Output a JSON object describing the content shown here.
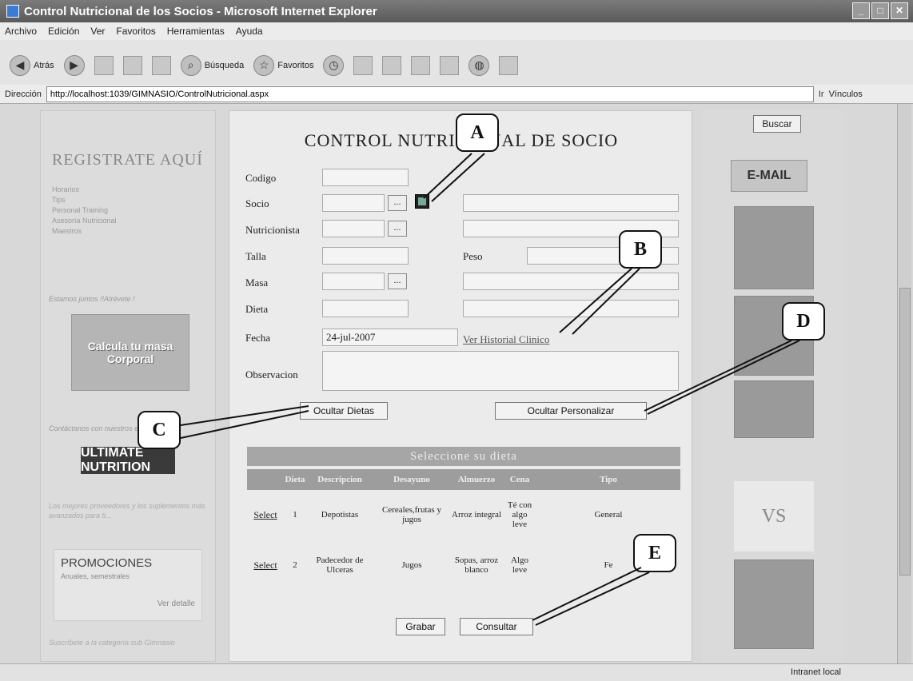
{
  "window": {
    "title": "Control Nutricional de los Socios - Microsoft Internet Explorer"
  },
  "menu": [
    "Archivo",
    "Edición",
    "Ver",
    "Favoritos",
    "Herramientas",
    "Ayuda"
  ],
  "toolbar": {
    "back": "Atrás",
    "search": "Búsqueda",
    "favorites": "Favoritos"
  },
  "address": {
    "label": "Dirección",
    "url": "http://localhost:1039/GIMNASIO/ControlNutricional.aspx",
    "go": "Ir",
    "links": "Vínculos"
  },
  "left": {
    "register": "REGISTRATE AQUÍ",
    "links": [
      "Horarios",
      "Tips",
      "Personal Training",
      "Asesoría Nutricional",
      "Maestros"
    ],
    "note1": "Estamos juntos !!Atrévete !",
    "imc": "Calcula tu masa Corporal",
    "note2": "Contáctanos con nuestros expertos",
    "brand": "ULTIMATE NUTRITION",
    "note3": "Los mejores proveedores y los suplementos más avanzados para ti...",
    "promo_title": "PROMOCIONES",
    "promo_sub": "Anuales, semestrales",
    "promo_link": "Ver detalle",
    "note4": "Suscríbete a la categoría sub Gimnasio"
  },
  "form": {
    "title": "CONTROL NUTRICIONAL DE SOCIO",
    "labels": {
      "codigo": "Codigo",
      "socio": "Socio",
      "nutricionista": "Nutricionista",
      "talla": "Talla",
      "peso": "Peso",
      "masa": "Masa",
      "dieta": "Dieta",
      "fecha": "Fecha",
      "observacion": "Observacion"
    },
    "fecha_value": "24-jul-2007",
    "dots": "...",
    "history_link": "Ver Historial Clinico",
    "btn_hide_diets": "Ocultar Dietas",
    "btn_hide_custom": "Ocultar Personalizar",
    "diet_header": "Seleccione su dieta",
    "columns": [
      "",
      "Dieta",
      "Descripcion",
      "Desayuno",
      "Almuerzo",
      "Cena",
      "Tipo"
    ],
    "rows": [
      {
        "select": "Select",
        "dieta": "1",
        "descripcion": "Depotistas",
        "desayuno": "Cereales,frutas y jugos",
        "almuerzo": "Arroz integral",
        "cena": "Té con algo leve",
        "tipo": "General"
      },
      {
        "select": "Select",
        "dieta": "2",
        "descripcion": "Padecedor de Ulceras",
        "desayuno": "Jugos",
        "almuerzo": "Sopas, arroz blanco",
        "cena": "Algo leve",
        "tipo": "Fe"
      }
    ],
    "btn_save": "Grabar",
    "btn_query": "Consultar"
  },
  "right": {
    "search": "Buscar",
    "email": "E-MAIL",
    "vs": "VS"
  },
  "status": {
    "zone": "Intranet local"
  },
  "callouts": [
    "A",
    "B",
    "C",
    "D",
    "E"
  ]
}
